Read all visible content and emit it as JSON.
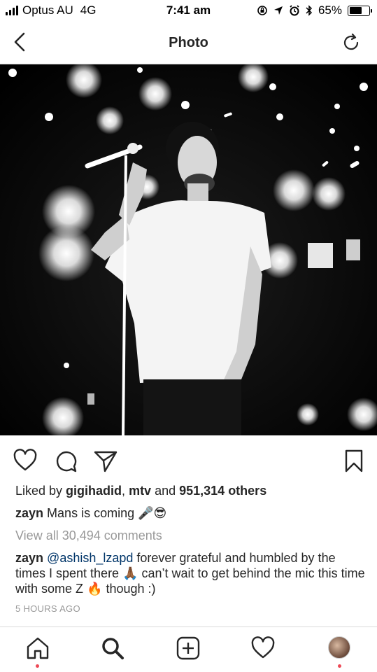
{
  "status_bar": {
    "carrier": "Optus AU",
    "network": "4G",
    "time": "7:41 am",
    "battery_percent": "65%",
    "battery_level": 0.65
  },
  "header": {
    "title": "Photo",
    "back_icon": "chevron-left-icon",
    "refresh_icon": "refresh-icon"
  },
  "post": {
    "likes_prefix": "Liked by ",
    "likes_user1": "gigihadid",
    "likes_sep1": ", ",
    "likes_user2": "mtv",
    "likes_and": " and ",
    "likes_count": "951,314 others",
    "caption_user": "zayn",
    "caption_text": "Mans is coming",
    "caption_emoji1": "🎤",
    "caption_emoji2": "😎",
    "view_all_comments": "View all 30,494 comments",
    "comment_user": "zayn",
    "comment_mention": "@ashish_lzapd",
    "comment_text1": " forever grateful and humbled by the times I spent there ",
    "comment_emoji1": "🙏🏾",
    "comment_text2": " can’t wait to get behind the mic this time with some Z ",
    "comment_emoji2": "🔥",
    "comment_text3": " though :)",
    "timestamp": "5 HOURS AGO"
  },
  "colors": {
    "text": "#262626",
    "muted": "#999999",
    "notification_dot": "#ed4956",
    "divider": "#dbdbdb"
  }
}
